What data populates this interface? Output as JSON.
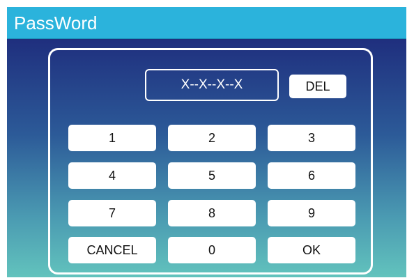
{
  "window": {
    "title": "PassWord"
  },
  "colors": {
    "titlebar": "#2bb3dc",
    "background_top": "#1f2f7e",
    "background_bottom": "#62c3bd",
    "key_fill": "#ffffff"
  },
  "password": {
    "display": "X--X--X--X"
  },
  "keypad": {
    "del_label": "DEL",
    "keys": [
      "1",
      "2",
      "3",
      "4",
      "5",
      "6",
      "7",
      "8",
      "9",
      "CANCEL",
      "0",
      "OK"
    ]
  }
}
